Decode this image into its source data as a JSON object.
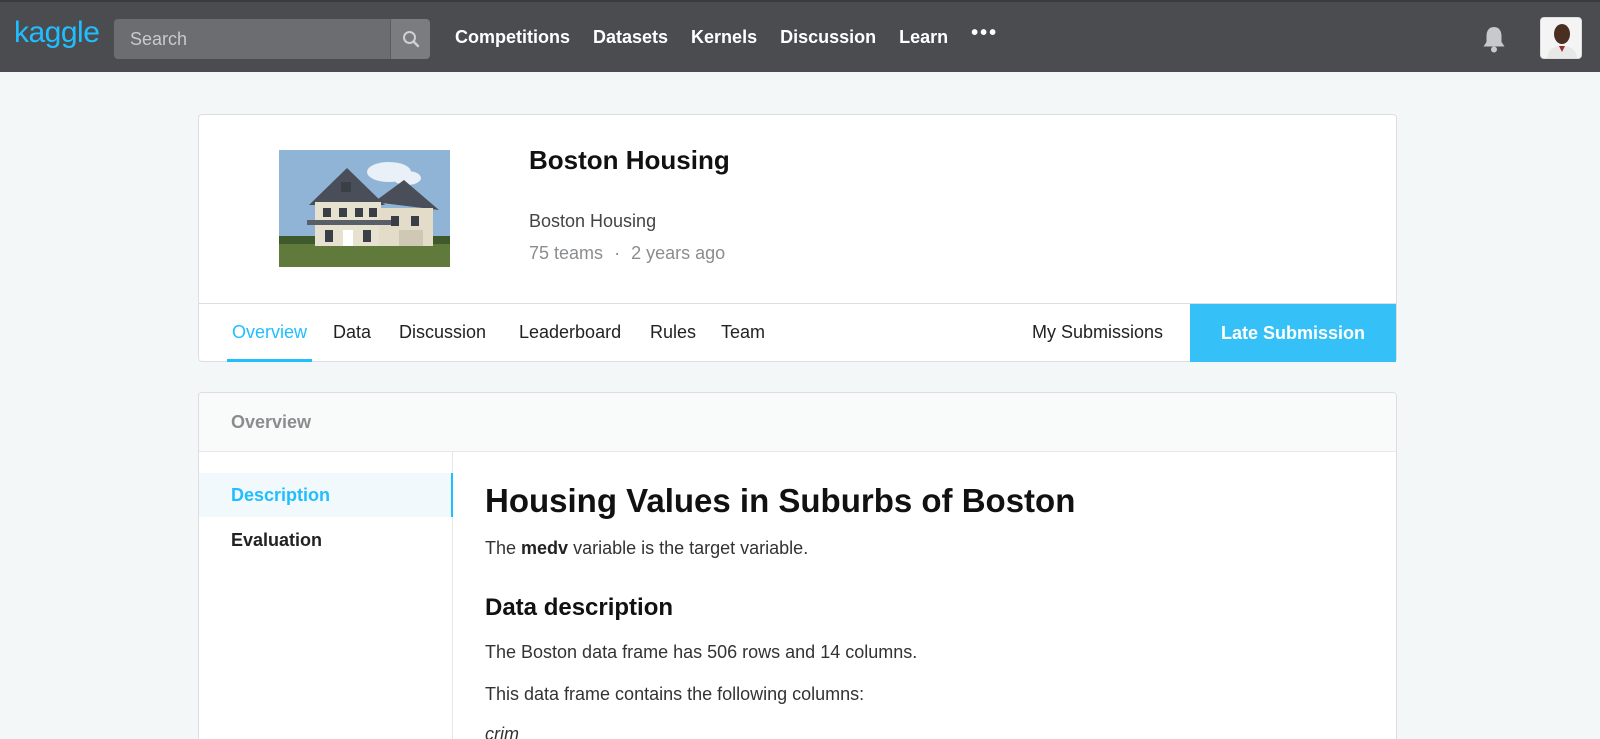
{
  "nav": {
    "logo": "kaggle",
    "search_placeholder": "Search",
    "links": [
      "Competitions",
      "Datasets",
      "Kernels",
      "Discussion",
      "Learn"
    ],
    "more": "•••"
  },
  "competition": {
    "title": "Boston Housing",
    "subtitle": "Boston Housing",
    "teams": "75 teams",
    "separator": "·",
    "age": "2 years ago"
  },
  "tabs": [
    "Overview",
    "Data",
    "Discussion",
    "Leaderboard",
    "Rules",
    "Team"
  ],
  "my_submissions": "My Submissions",
  "late_submission": "Late Submission",
  "overview": {
    "header": "Overview",
    "side_items": [
      "Description",
      "Evaluation"
    ],
    "heading": "Housing Values in Suburbs of Boston",
    "intro_pre": "The ",
    "intro_bold": "medv",
    "intro_post": " variable is the target variable.",
    "subheading": "Data description",
    "para1": "The Boston data frame has 506 rows and 14 columns.",
    "para2": "This data frame contains the following columns:",
    "first_column": "crim"
  },
  "colors": {
    "accent": "#20beff",
    "nav_bg": "#4a4c50"
  }
}
